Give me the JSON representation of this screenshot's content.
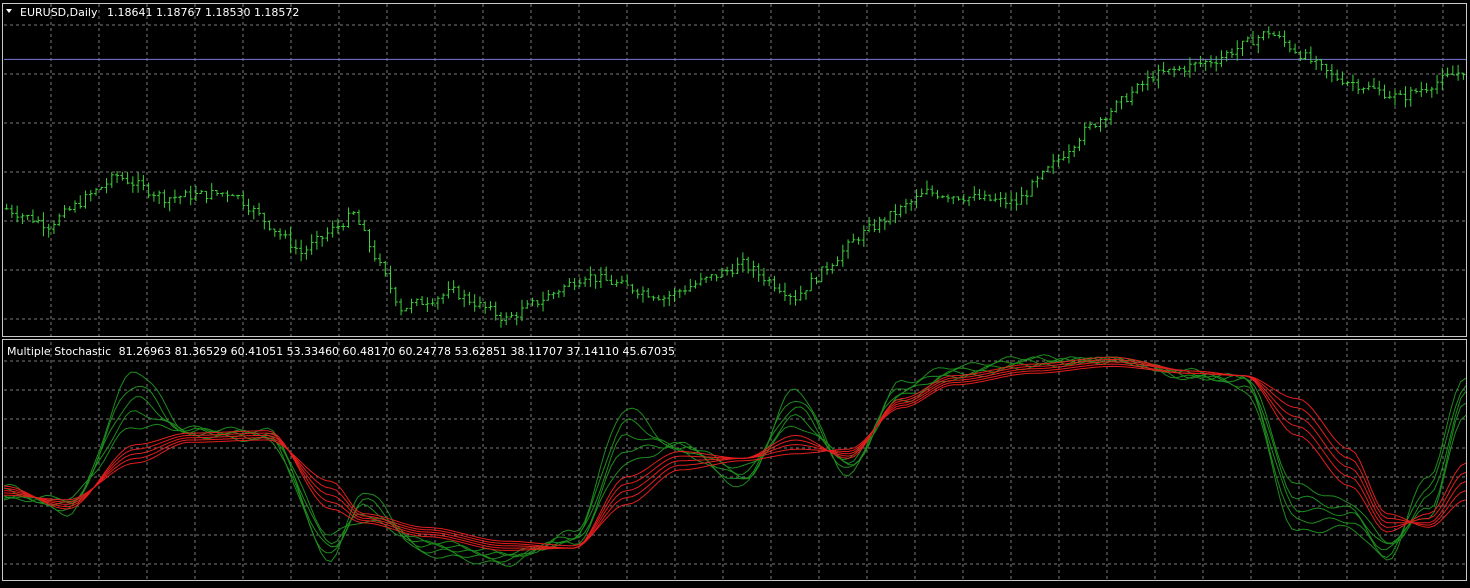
{
  "colors": {
    "background": "#000000",
    "frame": "#c8c8c8",
    "grid": "#7a7a7a",
    "candles": "#3cd23c",
    "fast_lines": "#1e8c1e",
    "slow_lines": "#e11e1e",
    "price_level_line": "#7a7ad6"
  },
  "icons": {
    "symbol_dropdown": "triangle-down-icon"
  },
  "chart_data": [
    {
      "type": "candlestick",
      "title": "EURUSD,Daily",
      "ohlc_header": "1.18641 1.18767 1.18530 1.18572",
      "bars": 278,
      "price_range": [
        1.138,
        1.198
      ],
      "price_level_line": 1.188,
      "grid": true,
      "trend_anchors": [
        {
          "bar": 0,
          "close": 1.161
        },
        {
          "bar": 8,
          "close": 1.158
        },
        {
          "bar": 21,
          "close": 1.167
        },
        {
          "bar": 30,
          "close": 1.163
        },
        {
          "bar": 43,
          "close": 1.164
        },
        {
          "bar": 56,
          "close": 1.153
        },
        {
          "bar": 66,
          "close": 1.16
        },
        {
          "bar": 75,
          "close": 1.143
        },
        {
          "bar": 85,
          "close": 1.146
        },
        {
          "bar": 95,
          "close": 1.141
        },
        {
          "bar": 110,
          "close": 1.149
        },
        {
          "bar": 125,
          "close": 1.145
        },
        {
          "bar": 140,
          "close": 1.151
        },
        {
          "bar": 150,
          "close": 1.145
        },
        {
          "bar": 162,
          "close": 1.156
        },
        {
          "bar": 175,
          "close": 1.164
        },
        {
          "bar": 192,
          "close": 1.162
        },
        {
          "bar": 205,
          "close": 1.175
        },
        {
          "bar": 218,
          "close": 1.185
        },
        {
          "bar": 230,
          "close": 1.188
        },
        {
          "bar": 240,
          "close": 1.193
        },
        {
          "bar": 252,
          "close": 1.185
        },
        {
          "bar": 265,
          "close": 1.181
        },
        {
          "bar": 277,
          "close": 1.186
        }
      ]
    },
    {
      "type": "line",
      "title": "Multiple Stochastic",
      "header_values": "81.26963 81.36529 60.41051 53.33460 60.48170 60.24778 53.62851 38.11707 37.14110 45.67035",
      "ylim": [
        0,
        100
      ],
      "grid": true,
      "points": 278,
      "key_x": [
        0,
        12,
        25,
        35,
        50,
        62,
        68,
        80,
        95,
        108,
        118,
        128,
        140,
        150,
        160,
        170,
        180,
        195,
        210,
        225,
        235,
        245,
        255,
        262,
        270,
        277
      ],
      "series": [
        {
          "group": "fast",
          "values": [
            40,
            28,
            90,
            64,
            61,
            8,
            38,
            10,
            6,
            20,
            74,
            55,
            40,
            82,
            45,
            85,
            92,
            96,
            94,
            90,
            82,
            20,
            22,
            8,
            45,
            88
          ]
        },
        {
          "group": "fast",
          "values": [
            38,
            30,
            84,
            62,
            60,
            10,
            34,
            12,
            8,
            18,
            68,
            56,
            42,
            78,
            47,
            83,
            90,
            95,
            95,
            89,
            84,
            25,
            25,
            10,
            40,
            84
          ]
        },
        {
          "group": "fast",
          "values": [
            36,
            32,
            78,
            63,
            62,
            13,
            31,
            14,
            9,
            17,
            62,
            57,
            44,
            74,
            49,
            81,
            89,
            94,
            95,
            88,
            86,
            30,
            28,
            12,
            35,
            80
          ]
        },
        {
          "group": "fast",
          "values": [
            35,
            33,
            72,
            64,
            63,
            16,
            28,
            15,
            10,
            16,
            56,
            58,
            46,
            70,
            51,
            79,
            88,
            93,
            95,
            87,
            87,
            35,
            30,
            14,
            30,
            76
          ]
        },
        {
          "group": "fast",
          "values": [
            34,
            35,
            66,
            65,
            64,
            19,
            25,
            16,
            11,
            15,
            50,
            58,
            48,
            66,
            52,
            77,
            87,
            92,
            95,
            87,
            88,
            40,
            33,
            16,
            27,
            72
          ]
        },
        {
          "group": "slow",
          "values": [
            40,
            30,
            58,
            63,
            64,
            30,
            24,
            18,
            12,
            13,
            44,
            55,
            52,
            62,
            52,
            78,
            88,
            93,
            96,
            90,
            88,
            62,
            40,
            20,
            28,
            50
          ]
        },
        {
          "group": "slow",
          "values": [
            39,
            31,
            56,
            62,
            63,
            33,
            25,
            19,
            13,
            13,
            41,
            53,
            52,
            60,
            53,
            77,
            87,
            92,
            95,
            90,
            88,
            66,
            44,
            22,
            26,
            46
          ]
        },
        {
          "group": "slow",
          "values": [
            38,
            32,
            54,
            61,
            62,
            36,
            26,
            20,
            14,
            13,
            38,
            51,
            52,
            58,
            54,
            76,
            86,
            91,
            94,
            90,
            88,
            70,
            48,
            24,
            24,
            42
          ]
        },
        {
          "group": "slow",
          "values": [
            37,
            33,
            52,
            60,
            61,
            39,
            27,
            21,
            15,
            13,
            35,
            49,
            52,
            56,
            55,
            75,
            85,
            90,
            93,
            89,
            88,
            74,
            52,
            26,
            23,
            38
          ]
        },
        {
          "group": "slow",
          "values": [
            36,
            34,
            50,
            59,
            60,
            42,
            28,
            22,
            16,
            14,
            32,
            47,
            51,
            54,
            56,
            74,
            84,
            89,
            92,
            89,
            88,
            78,
            56,
            28,
            22,
            34
          ]
        }
      ]
    }
  ]
}
